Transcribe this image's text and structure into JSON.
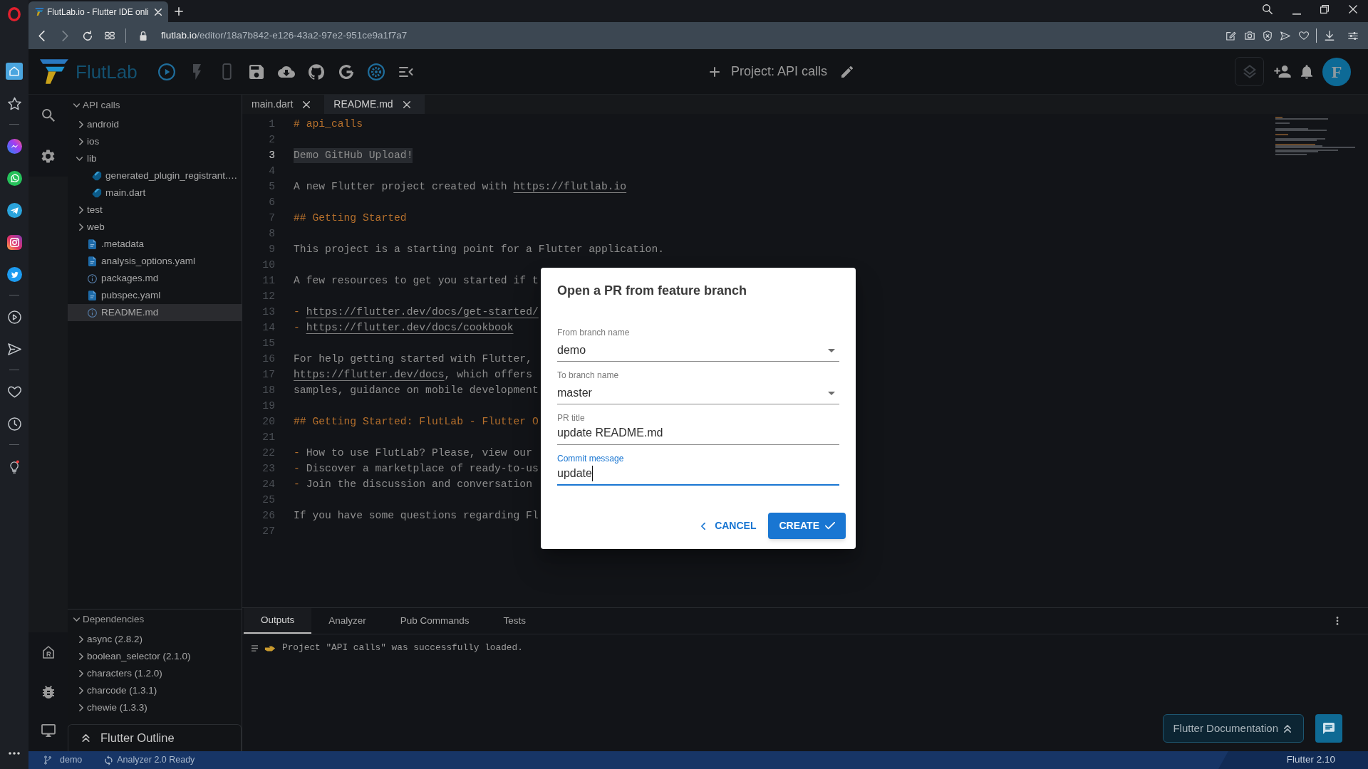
{
  "browser": {
    "tab": {
      "title": "FlutLab.io - Flutter IDE onli"
    },
    "address_bar": {
      "host": "flutlab.io",
      "path": "/editor/18a7b842-e126-43a2-97e2-951ce9a1f7a7"
    }
  },
  "opera_sidebar": {
    "items": [
      {
        "selected": true
      },
      {
        "selected": false
      },
      {
        "selected": false
      },
      {
        "selected": false
      },
      {
        "selected": false
      },
      {
        "selected": false
      },
      {
        "selected": false
      },
      {
        "selected": false
      },
      {
        "selected": false
      },
      {
        "selected": false
      },
      {
        "selected": false
      },
      {
        "selected": false
      }
    ]
  },
  "toolbar": {
    "logo_text": "FlutLab",
    "buttons": [
      {
        "disabled": false
      },
      {
        "disabled": true
      },
      {
        "disabled": true
      },
      {
        "disabled": false
      },
      {
        "disabled": false
      },
      {
        "disabled": false
      },
      {
        "disabled": false
      },
      {
        "disabled": false
      },
      {
        "disabled": false
      }
    ],
    "project_title": "Project: API calls",
    "avatar_letter": "F"
  },
  "file_tree": {
    "label": "API calls",
    "expanded": true,
    "children": [
      {
        "label": "android",
        "kind": "folder",
        "expanded": false,
        "selected": false
      },
      {
        "label": "ios",
        "kind": "folder",
        "expanded": false,
        "selected": false
      },
      {
        "label": "lib",
        "kind": "folder",
        "expanded": true,
        "selected": false,
        "children": [
          {
            "label": "generated_plugin_registrant.…",
            "kind": "dart",
            "selected": false
          },
          {
            "label": "main.dart",
            "kind": "dart",
            "selected": false
          }
        ]
      },
      {
        "label": "test",
        "kind": "folder",
        "expanded": false,
        "selected": false
      },
      {
        "label": "web",
        "kind": "folder",
        "expanded": false,
        "selected": false
      },
      {
        "label": ".metadata",
        "kind": "plain",
        "selected": false
      },
      {
        "label": "analysis_options.yaml",
        "kind": "plain",
        "selected": false
      },
      {
        "label": "packages.md",
        "kind": "markdown",
        "selected": false
      },
      {
        "label": "pubspec.yaml",
        "kind": "plain",
        "selected": false
      },
      {
        "label": "README.md",
        "kind": "markdown",
        "selected": true
      }
    ]
  },
  "dependencies": {
    "label": "Dependencies",
    "expanded": true,
    "children": [
      {
        "label": "async (2.8.2)",
        "expanded": false
      },
      {
        "label": "boolean_selector (2.1.0)",
        "expanded": false
      },
      {
        "label": "characters (1.2.0)",
        "expanded": false
      },
      {
        "label": "charcode (1.3.1)",
        "expanded": false
      },
      {
        "label": "chewie (1.3.3)",
        "expanded": false
      }
    ]
  },
  "outline": {
    "title": "Flutter Outline"
  },
  "editor": {
    "tabs": [
      {
        "label": "main.dart",
        "selected": false
      },
      {
        "label": "README.md",
        "selected": true
      }
    ],
    "lines": [
      {
        "number": "1",
        "selected": false,
        "segments": [
          {
            "kind": "heading",
            "text": "# api_calls"
          }
        ]
      },
      {
        "number": "2",
        "selected": false
      },
      {
        "number": "3",
        "selected": true,
        "segments": [
          {
            "kind": "text",
            "text": "Demo GitHub Upload!"
          }
        ]
      },
      {
        "number": "4",
        "selected": false
      },
      {
        "number": "5",
        "selected": false,
        "segments": [
          {
            "kind": "text",
            "text": "A new Flutter project created with "
          },
          {
            "kind": "link",
            "text": "https://flutlab.io"
          }
        ]
      },
      {
        "number": "6",
        "selected": false
      },
      {
        "number": "7",
        "selected": false,
        "segments": [
          {
            "kind": "heading",
            "text": "## Getting Started"
          }
        ]
      },
      {
        "number": "8",
        "selected": false
      },
      {
        "number": "9",
        "selected": false,
        "segments": [
          {
            "kind": "text",
            "text": "This project is a starting point for a Flutter application."
          }
        ]
      },
      {
        "number": "10",
        "selected": false
      },
      {
        "number": "11",
        "selected": false,
        "segments": [
          {
            "kind": "text",
            "text": "A few resources to get you started if t"
          }
        ]
      },
      {
        "number": "12",
        "selected": false
      },
      {
        "number": "13",
        "selected": false,
        "segments": [
          {
            "kind": "marker",
            "text": "- "
          },
          {
            "kind": "link",
            "text": "https://flutter.dev/docs/get-started/"
          }
        ]
      },
      {
        "number": "14",
        "selected": false,
        "segments": [
          {
            "kind": "marker",
            "text": "- "
          },
          {
            "kind": "link",
            "text": "https://flutter.dev/docs/cookbook"
          }
        ]
      },
      {
        "number": "15",
        "selected": false
      },
      {
        "number": "16",
        "selected": false,
        "segments": [
          {
            "kind": "text",
            "text": "For help getting started with Flutter,"
          }
        ]
      },
      {
        "number": "17",
        "selected": false,
        "segments": [
          {
            "kind": "link",
            "text": "https://flutter.dev/docs"
          },
          {
            "kind": "text",
            "text": ", which offers"
          }
        ]
      },
      {
        "number": "18",
        "selected": false,
        "segments": [
          {
            "kind": "text",
            "text": "samples, guidance on mobile development"
          }
        ]
      },
      {
        "number": "19",
        "selected": false
      },
      {
        "number": "20",
        "selected": false,
        "segments": [
          {
            "kind": "heading",
            "text": "## Getting Started: FlutLab - Flutter O"
          }
        ]
      },
      {
        "number": "21",
        "selected": false
      },
      {
        "number": "22",
        "selected": false,
        "segments": [
          {
            "kind": "marker",
            "text": "- "
          },
          {
            "kind": "text",
            "text": "How to use FlutLab? Please, view our"
          }
        ]
      },
      {
        "number": "23",
        "selected": false,
        "segments": [
          {
            "kind": "marker",
            "text": "- "
          },
          {
            "kind": "text",
            "text": "Discover a marketplace of ready-to-us"
          }
        ]
      },
      {
        "number": "24",
        "selected": false,
        "segments": [
          {
            "kind": "marker",
            "text": "- "
          },
          {
            "kind": "text",
            "text": "Join the discussion and conversation"
          }
        ]
      },
      {
        "number": "25",
        "selected": false
      },
      {
        "number": "26",
        "selected": false,
        "segments": [
          {
            "kind": "text",
            "text": "If you have some questions regarding Fl"
          }
        ]
      },
      {
        "number": "27",
        "selected": false
      }
    ]
  },
  "bottom_panel": {
    "tabs": [
      {
        "label": "Outputs",
        "selected": true
      },
      {
        "label": "Analyzer",
        "selected": false
      },
      {
        "label": "Pub Commands",
        "selected": false
      },
      {
        "label": "Tests",
        "selected": false
      }
    ],
    "messages": [
      {
        "text": "Project \"API calls\" was successfully loaded."
      }
    ],
    "docs_button": {
      "label": "Flutter Documentation"
    }
  },
  "status_bar": {
    "branch": "demo",
    "analyzer": "Analyzer 2.0 Ready",
    "version": "Flutter 2.10"
  },
  "dialog": {
    "title": "Open a PR from feature branch",
    "fields": [
      {
        "kind": "select",
        "label": "From branch name",
        "value": "demo",
        "focused": false
      },
      {
        "kind": "select",
        "label": "To branch name",
        "value": "master",
        "focused": false
      },
      {
        "kind": "text",
        "label": "PR title",
        "value": "update README.md",
        "focused": false
      },
      {
        "kind": "text",
        "label": "Commit message",
        "value": "update",
        "focused": true
      }
    ],
    "buttons": [
      {
        "kind": "text",
        "label": "CANCEL"
      },
      {
        "kind": "contained",
        "label": "CREATE"
      }
    ]
  }
}
